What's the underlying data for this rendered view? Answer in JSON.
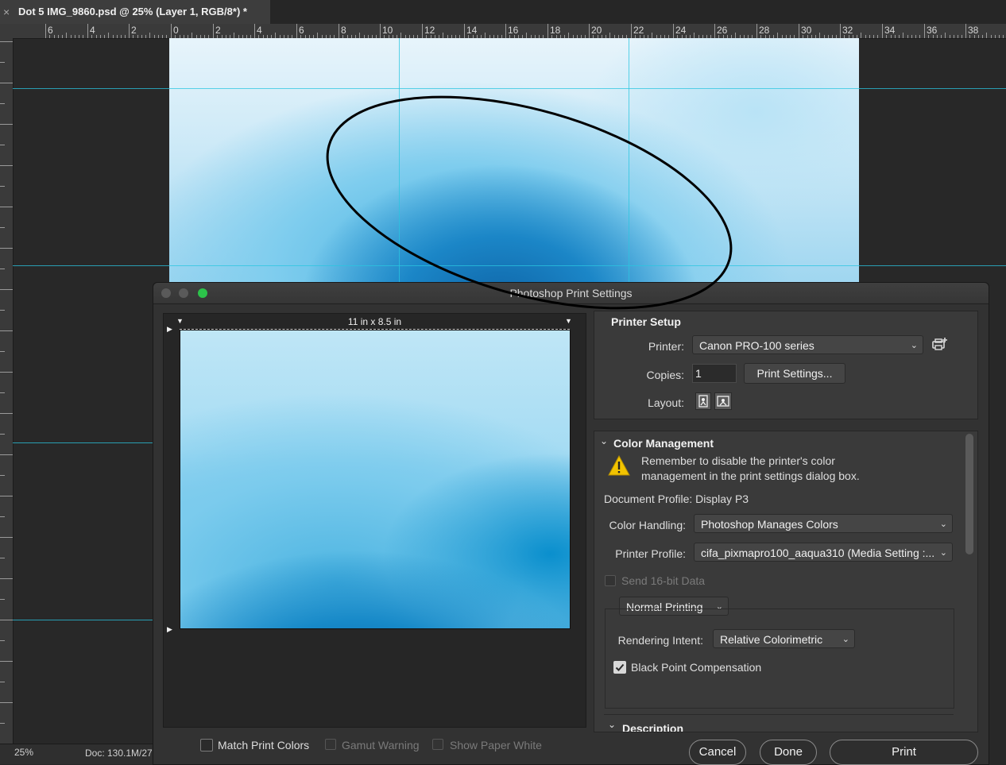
{
  "document_tab": {
    "close_glyph": "×",
    "title": "Dot 5 IMG_9860.psd @ 25% (Layer 1, RGB/8*) *"
  },
  "ruler": {
    "horizontal_labels": [
      "6",
      "4",
      "2",
      "0",
      "2",
      "4",
      "6",
      "8",
      "10",
      "12",
      "14",
      "16",
      "18",
      "20",
      "22",
      "24",
      "26",
      "28",
      "30",
      "32",
      "34",
      "36",
      "38"
    ]
  },
  "status_bar": {
    "zoom": "25%",
    "doc_info": "Doc: 130.1M/27"
  },
  "dialog": {
    "title": "Photoshop Print Settings",
    "preview": {
      "paper_size": "11 in x 8.5 in"
    },
    "printer_setup": {
      "title": "Printer Setup",
      "printer_label": "Printer:",
      "printer_value": "Canon PRO-100 series",
      "copies_label": "Copies:",
      "copies_value": "1",
      "print_settings_button": "Print Settings...",
      "layout_label": "Layout:"
    },
    "color_management": {
      "title": "Color Management",
      "warning_line1": "Remember to disable the printer's color",
      "warning_line2": "management in the print settings dialog box.",
      "document_profile": "Document Profile: Display P3",
      "color_handling_label": "Color Handling:",
      "color_handling_value": "Photoshop Manages Colors",
      "printer_profile_label": "Printer Profile:",
      "printer_profile_value": "cifa_pixmapro100_aaqua310 (Media Setting :...",
      "send16_label": "Send 16-bit Data",
      "mode_value": "Normal Printing",
      "rendering_intent_label": "Rendering Intent:",
      "rendering_intent_value": "Relative Colorimetric",
      "black_point_label": "Black Point Compensation",
      "black_point_checked": true,
      "description_title": "Description"
    },
    "footer": {
      "match_print_colors": "Match Print Colors",
      "gamut_warning": "Gamut Warning",
      "show_paper_white": "Show Paper White",
      "cancel": "Cancel",
      "done": "Done",
      "print": "Print"
    }
  },
  "colors": {
    "guide": "#29c6e0",
    "annotation_ellipse": "#000000",
    "traffic_green": "#2cc24a"
  }
}
